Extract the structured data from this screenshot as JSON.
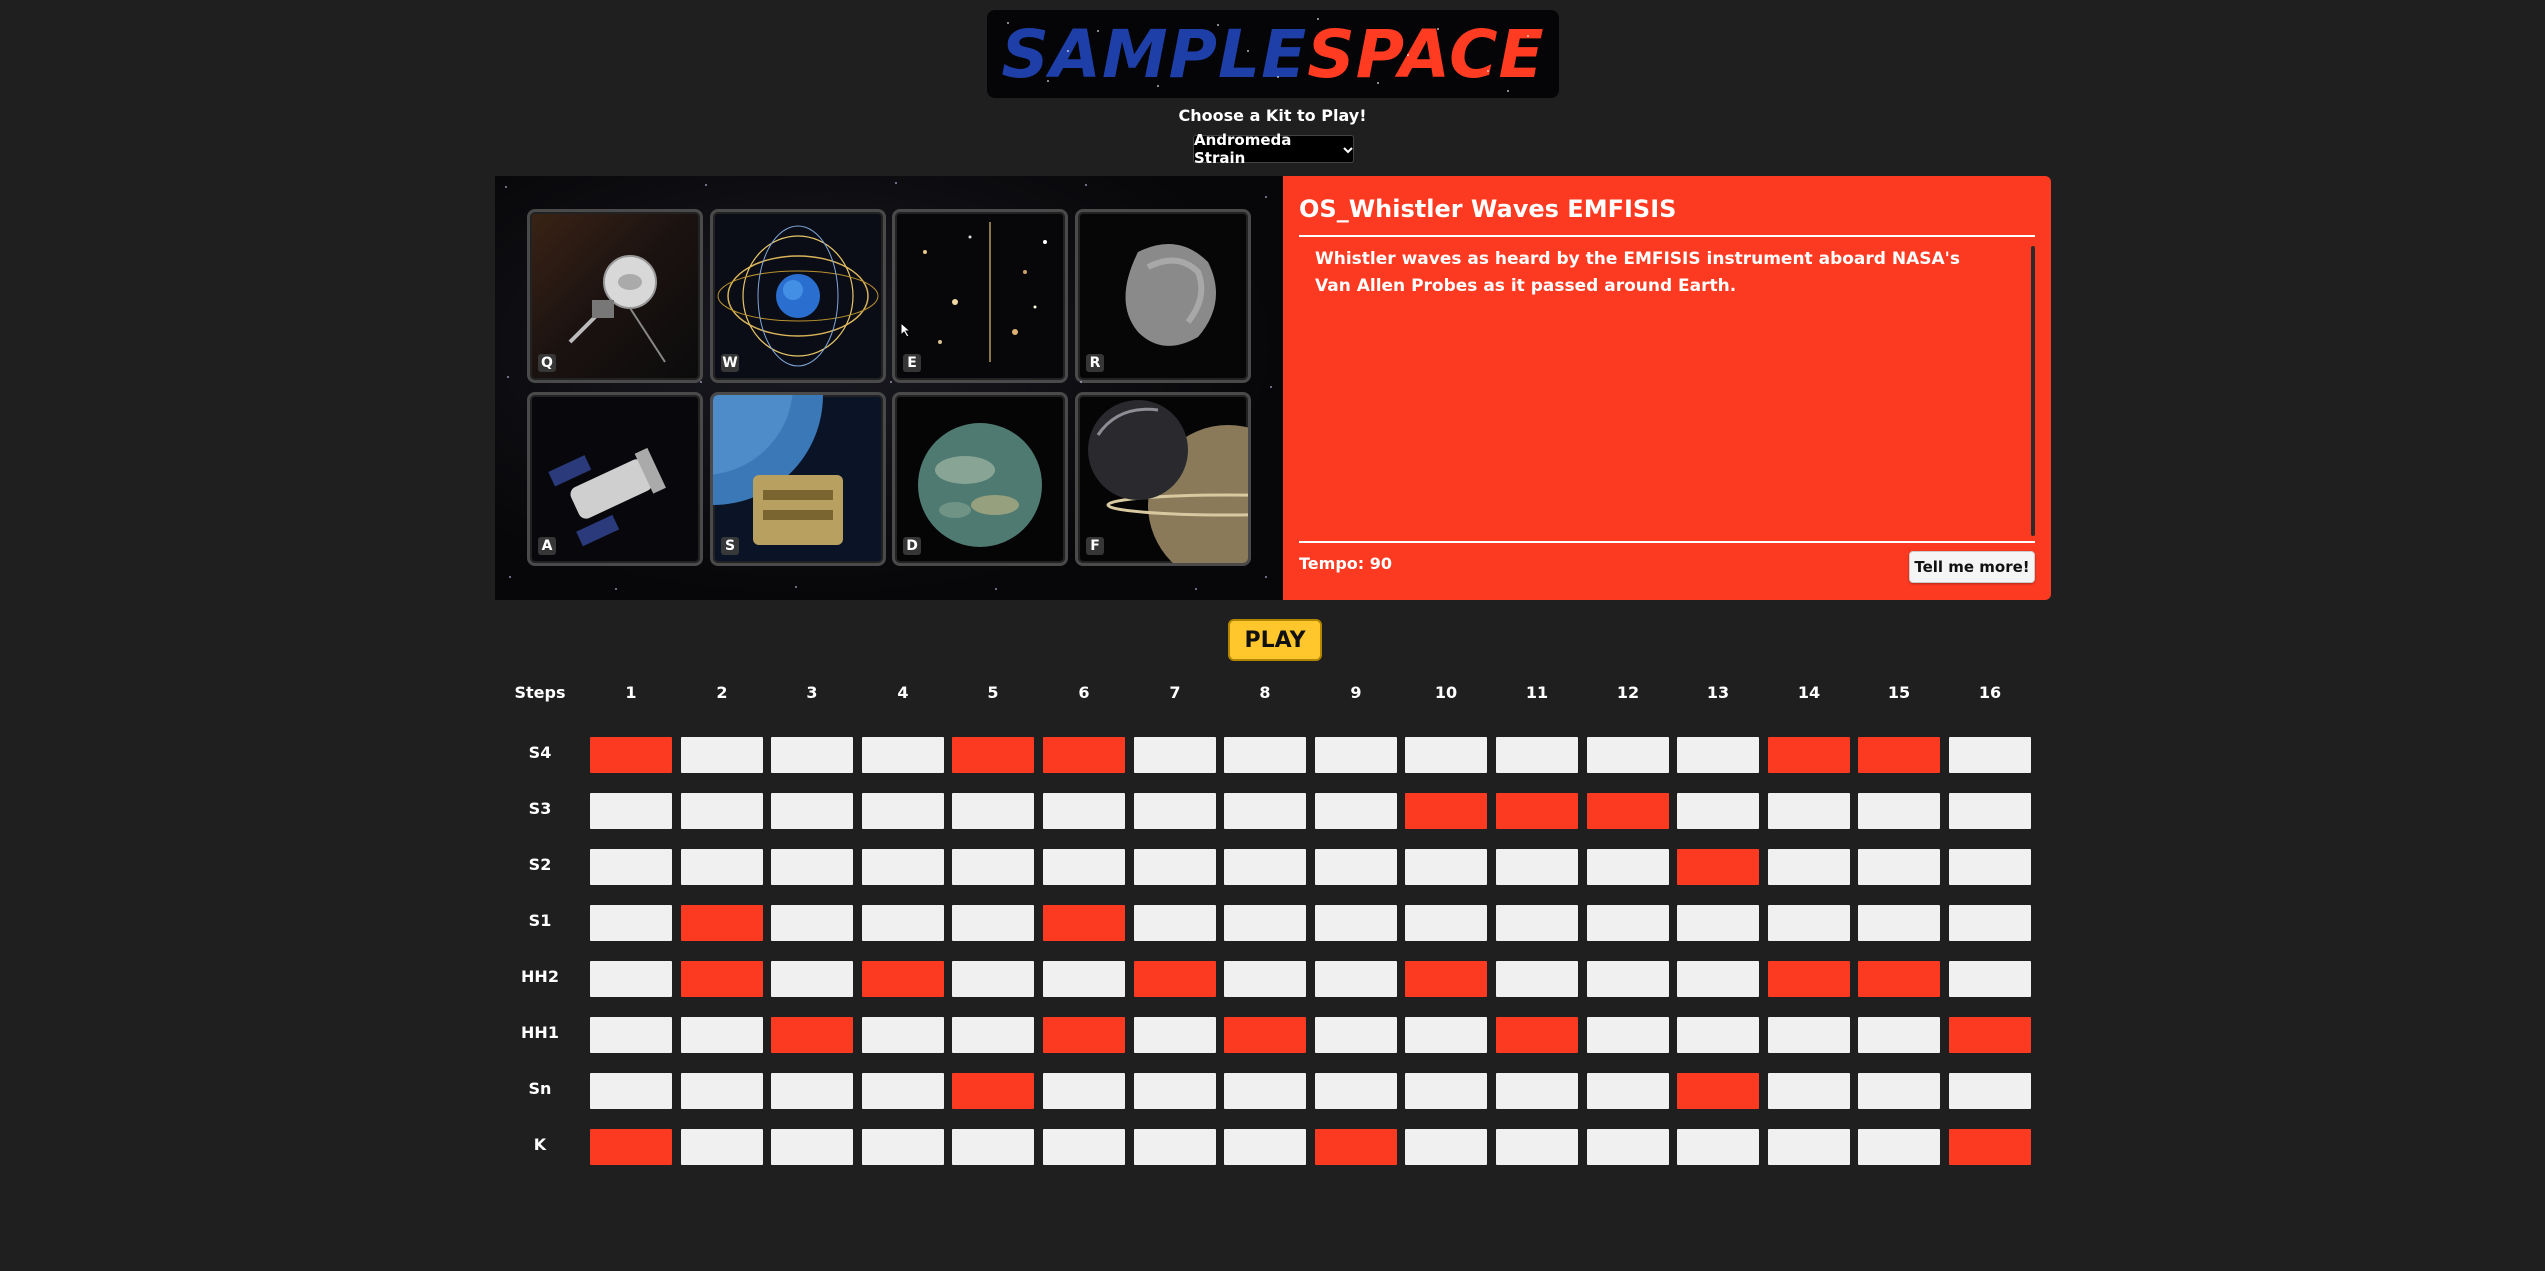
{
  "logo": {
    "part1": "SAMPLE",
    "part2": "SPACE"
  },
  "kit": {
    "prompt": "Choose a Kit to Play!",
    "selected": "Andromeda Strain"
  },
  "pads": [
    {
      "key": "Q",
      "image": "voyager-probe"
    },
    {
      "key": "W",
      "image": "magnetosphere-field-lines"
    },
    {
      "key": "E",
      "image": "deep-field-galaxies"
    },
    {
      "key": "R",
      "image": "comet-nucleus"
    },
    {
      "key": "A",
      "image": "kepler-telescope"
    },
    {
      "key": "S",
      "image": "satellite-over-earth"
    },
    {
      "key": "D",
      "image": "planet-titan"
    },
    {
      "key": "F",
      "image": "moon-and-saturn"
    }
  ],
  "info": {
    "title": "OS_Whistler Waves EMFISIS",
    "description": "Whistler waves as heard by the EMFISIS instrument aboard NASA's Van Allen Probes as it passed around Earth.",
    "tempo": "Tempo: 90",
    "more_label": "Tell me more!"
  },
  "play_label": "PLAY",
  "sequencer": {
    "header_label": "Steps",
    "steps": [
      "1",
      "2",
      "3",
      "4",
      "5",
      "6",
      "7",
      "8",
      "9",
      "10",
      "11",
      "12",
      "13",
      "14",
      "15",
      "16"
    ],
    "rows": [
      {
        "name": "S4",
        "pattern": [
          1,
          0,
          0,
          0,
          1,
          1,
          0,
          0,
          0,
          0,
          0,
          0,
          0,
          1,
          1,
          0
        ]
      },
      {
        "name": "S3",
        "pattern": [
          0,
          0,
          0,
          0,
          0,
          0,
          0,
          0,
          0,
          1,
          1,
          1,
          0,
          0,
          0,
          0
        ]
      },
      {
        "name": "S2",
        "pattern": [
          0,
          0,
          0,
          0,
          0,
          0,
          0,
          0,
          0,
          0,
          0,
          0,
          1,
          0,
          0,
          0
        ]
      },
      {
        "name": "S1",
        "pattern": [
          0,
          1,
          0,
          0,
          0,
          1,
          0,
          0,
          0,
          0,
          0,
          0,
          0,
          0,
          0,
          0
        ]
      },
      {
        "name": "HH2",
        "pattern": [
          0,
          1,
          0,
          1,
          0,
          0,
          1,
          0,
          0,
          1,
          0,
          0,
          0,
          1,
          1,
          0
        ]
      },
      {
        "name": "HH1",
        "pattern": [
          0,
          0,
          1,
          0,
          0,
          1,
          0,
          1,
          0,
          0,
          1,
          0,
          0,
          0,
          0,
          1
        ]
      },
      {
        "name": "Sn",
        "pattern": [
          0,
          0,
          0,
          0,
          1,
          0,
          0,
          0,
          0,
          0,
          0,
          0,
          1,
          0,
          0,
          0
        ]
      },
      {
        "name": "K",
        "pattern": [
          1,
          0,
          0,
          0,
          0,
          0,
          0,
          0,
          1,
          0,
          0,
          0,
          0,
          0,
          0,
          1
        ]
      }
    ]
  },
  "colors": {
    "accent": "#fc3a22",
    "play": "#ffc72c",
    "cell_off": "#f0f0f0",
    "logo_blue": "#1f3fa8"
  }
}
